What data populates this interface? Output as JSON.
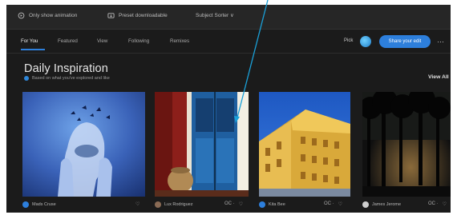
{
  "topbar": {
    "items": [
      {
        "label": "Only show animation",
        "icon": "animation-icon"
      },
      {
        "label": "Preset downloadable",
        "icon": "download-icon"
      },
      {
        "label": "Subject Sorter ∨",
        "icon": ""
      }
    ]
  },
  "tabs": {
    "items": [
      "For You",
      "Featured",
      "View",
      "Following",
      "Remixes"
    ]
  },
  "actions": {
    "pick_label": "Pick",
    "share_label": "Share your edit",
    "more_label": "…"
  },
  "section": {
    "title": "Daily Inspiration",
    "subtitle": "Based on what you've explored and like",
    "view_all": "View All"
  },
  "cards": [
    {
      "author": "Mads Cruse",
      "likes": "",
      "comments": ""
    },
    {
      "author": "Lux Rodriguez",
      "likes": "",
      "comments": "OC ·"
    },
    {
      "author": "Kita Bee",
      "likes": "",
      "comments": "OC ·"
    },
    {
      "author": "James Jerome",
      "likes": "",
      "comments": "OC ·"
    }
  ],
  "colors": {
    "accent": "#2d7fdc",
    "annotation": "#1aa0d8",
    "background": "#1b1b1b"
  }
}
